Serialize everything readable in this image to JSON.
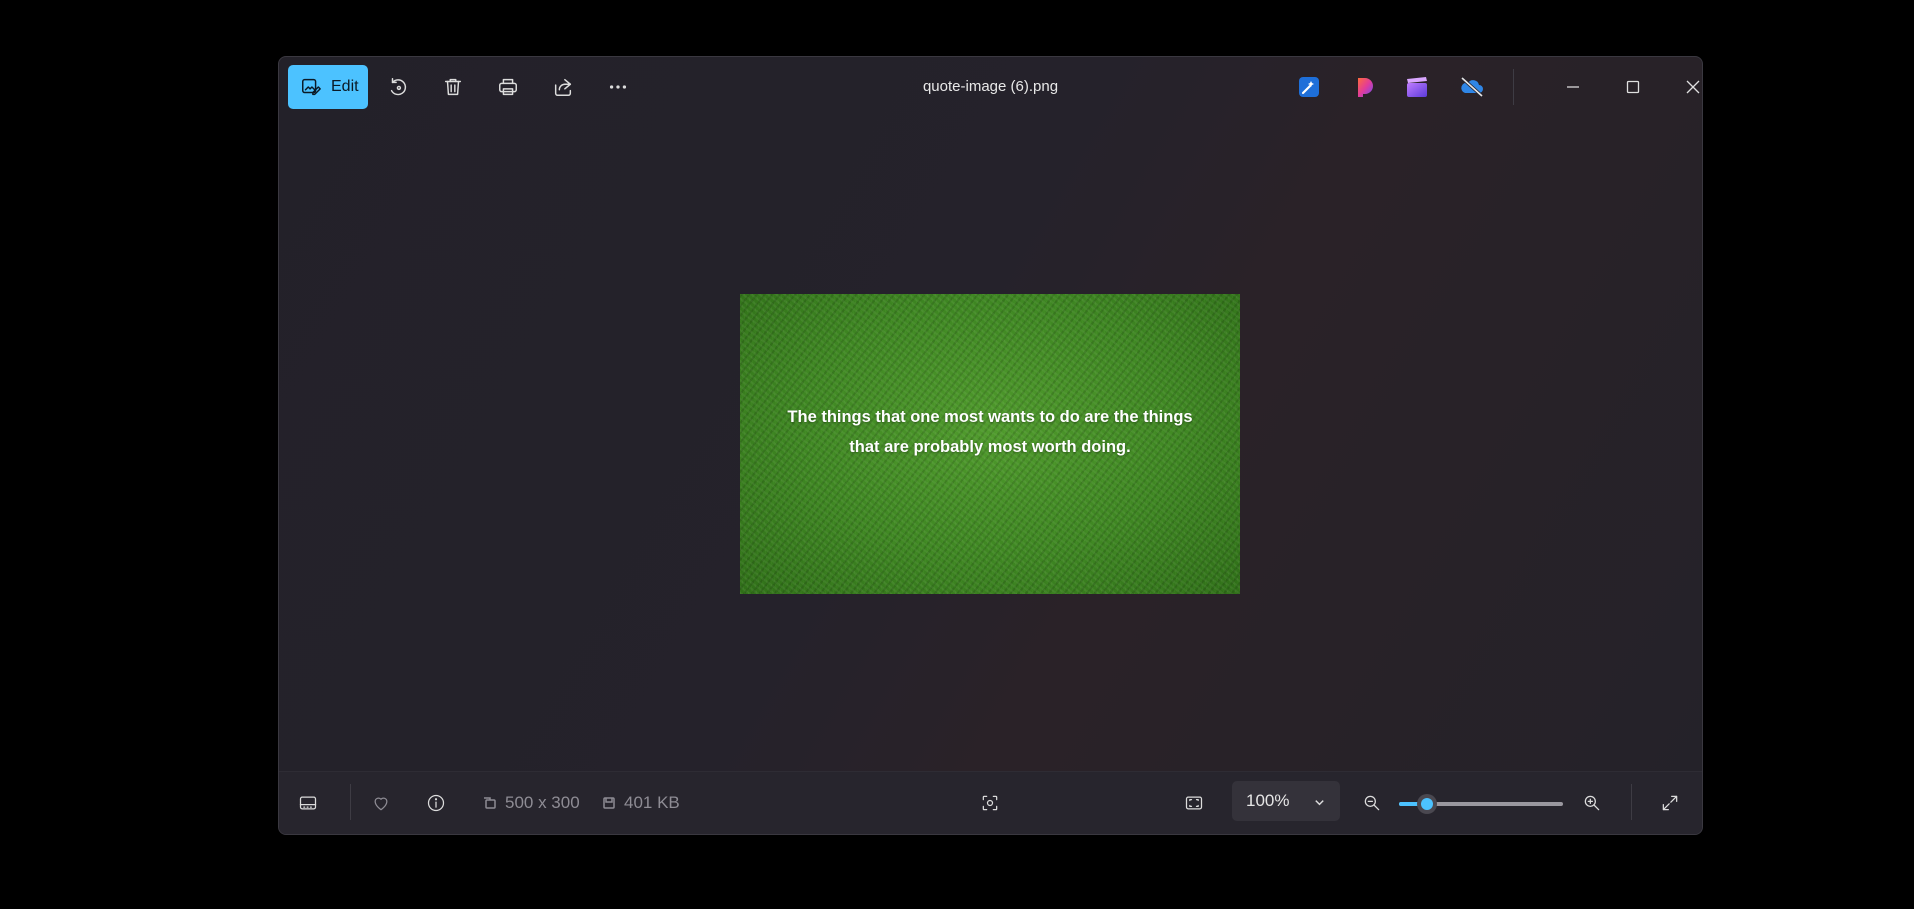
{
  "toolbar": {
    "edit_label": "Edit",
    "icons": [
      "rotate-icon",
      "delete-icon",
      "print-icon",
      "share-icon",
      "more-icon"
    ]
  },
  "window": {
    "title": "quote-image (6).png",
    "app_icons": [
      "designer-icon",
      "clipchamp-icon",
      "video-editor-icon",
      "onedrive-offline-icon"
    ]
  },
  "image": {
    "quote": "The things that one most wants to do are the things that are probably most worth doing."
  },
  "statusbar": {
    "dimensions": "500 x 300",
    "file_size": "401 KB",
    "zoom_value": "100%",
    "zoom_level_fraction": 0.17
  },
  "colors": {
    "accent": "#4cc2ff",
    "window_bg": "#232129",
    "bottombar_bg": "#27252d"
  }
}
